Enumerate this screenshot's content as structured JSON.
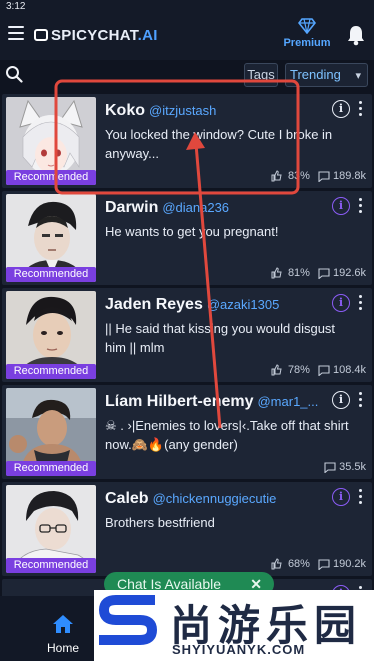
{
  "status": {
    "time": "3:12"
  },
  "header": {
    "logo_main": "SPICYCHAT",
    "logo_suffix": ".AI",
    "premium_label": "Premium"
  },
  "toolbar": {
    "tags_label": "Tags",
    "sort_value": "Trending"
  },
  "cards": [
    {
      "name": "Koko",
      "handle": "@itzjustash",
      "description": "You locked the window? Cute I broke in anyway...",
      "badge": "Recommended",
      "rating": "83%",
      "chats": "189.8k",
      "info_style": "white"
    },
    {
      "name": "Darwin",
      "handle": "@diana236",
      "description": "He wants to get you pregnant!",
      "badge": "Recommended",
      "rating": "81%",
      "chats": "192.6k",
      "info_style": "purple"
    },
    {
      "name": "Jaden Reyes",
      "handle": "@azaki1305",
      "description": "|| He said that kissing you would disgust him || mlm",
      "badge": "Recommended",
      "rating": "78%",
      "chats": "108.4k",
      "info_style": "purple"
    },
    {
      "name": "Lίam Hilbert-enemy",
      "handle": "@mar1_...",
      "description": "☠︎ . ›|Enemies to lovers|‹.Take off that shirt now.🙈🔥(any gender)",
      "badge": "Recommended",
      "rating": "",
      "chats": "35.5k",
      "info_style": "white"
    },
    {
      "name": "Caleb",
      "handle": "@chickennuggiecutie",
      "description": "Brothers bestfriend",
      "badge": "Recommended",
      "rating": "68%",
      "chats": "190.2k",
      "info_style": "purple"
    }
  ],
  "chat_pill": {
    "label": "Chat Is Available",
    "close": "✕"
  },
  "bottom_nav": {
    "home_label": "Home"
  },
  "watermark": {
    "title": "尚游乐园",
    "subtitle": "SHYIYUANYK.COM"
  },
  "colors": {
    "accent": "#4fa0ff",
    "badge": "#7a3fe0",
    "annotation": "#e0483d",
    "chat_pill": "#1f8a54"
  }
}
